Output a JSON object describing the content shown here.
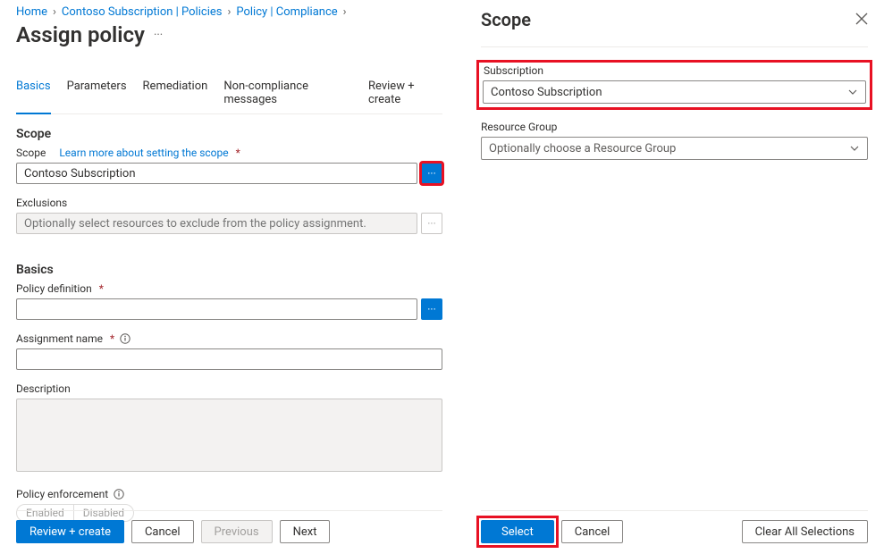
{
  "breadcrumb": {
    "items": [
      {
        "label": "Home"
      },
      {
        "label": "Contoso Subscription | Policies"
      },
      {
        "label": "Policy | Compliance"
      }
    ]
  },
  "pageTitle": "Assign policy",
  "tabs": [
    {
      "label": "Basics",
      "active": true
    },
    {
      "label": "Parameters",
      "active": false
    },
    {
      "label": "Remediation",
      "active": false
    },
    {
      "label": "Non-compliance messages",
      "active": false
    },
    {
      "label": "Review + create",
      "active": false
    }
  ],
  "scope": {
    "sectionHeading": "Scope",
    "scopeLabel": "Scope",
    "learnMoreLink": "Learn more about setting the scope",
    "scopeValue": "Contoso Subscription",
    "exclusionsLabel": "Exclusions",
    "exclusionsPlaceholder": "Optionally select resources to exclude from the policy assignment."
  },
  "basics": {
    "sectionHeading": "Basics",
    "policyDefLabel": "Policy definition",
    "policyDefValue": "",
    "assignmentNameLabel": "Assignment name",
    "assignmentNameValue": "",
    "descriptionLabel": "Description",
    "descriptionValue": "",
    "enforcementLabel": "Policy enforcement",
    "enforcementEnabled": "Enabled",
    "enforcementDisabled": "Disabled"
  },
  "footer": {
    "reviewCreate": "Review + create",
    "cancel": "Cancel",
    "previous": "Previous",
    "next": "Next"
  },
  "slideout": {
    "title": "Scope",
    "subscriptionLabel": "Subscription",
    "subscriptionValue": "Contoso Subscription",
    "resourceGroupLabel": "Resource Group",
    "resourceGroupPlaceholder": "Optionally choose a Resource Group",
    "select": "Select",
    "cancel": "Cancel",
    "clearAll": "Clear All Selections"
  }
}
